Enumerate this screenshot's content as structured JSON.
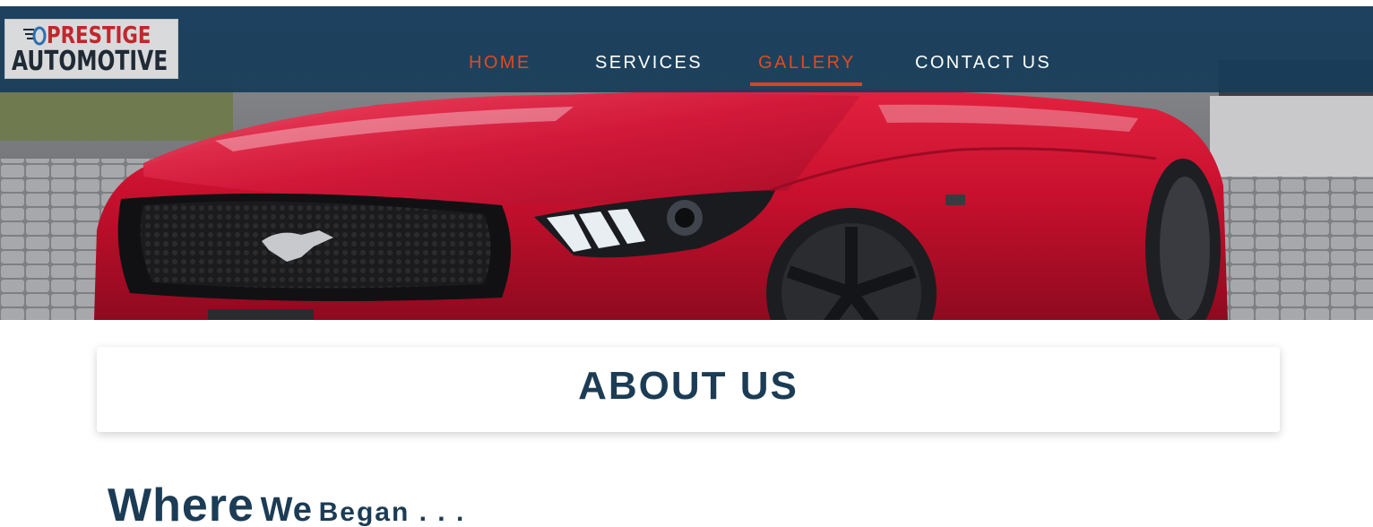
{
  "brand": {
    "logo_line1": "PRESTIGE",
    "logo_line2": "AUTOMOTIVE",
    "colors": {
      "logo_red": "#c1272d",
      "logo_dark": "#1f2a35",
      "logo_blue": "#2f6fae"
    }
  },
  "nav": {
    "items": [
      {
        "label": "HOME"
      },
      {
        "label": "SERVICES"
      },
      {
        "label": "GALLERY"
      },
      {
        "label": "CONTACT US"
      }
    ],
    "active": "GALLERY",
    "colors": {
      "bar": "#193e5c",
      "text": "#ffffff",
      "accent": "#e04a1f"
    }
  },
  "hero": {
    "image": "red-mustang-car-photo"
  },
  "about": {
    "title": "ABOUT US"
  },
  "section": {
    "heading_part1": "Where",
    "heading_part2": "We",
    "heading_part3": "Began . . ."
  }
}
